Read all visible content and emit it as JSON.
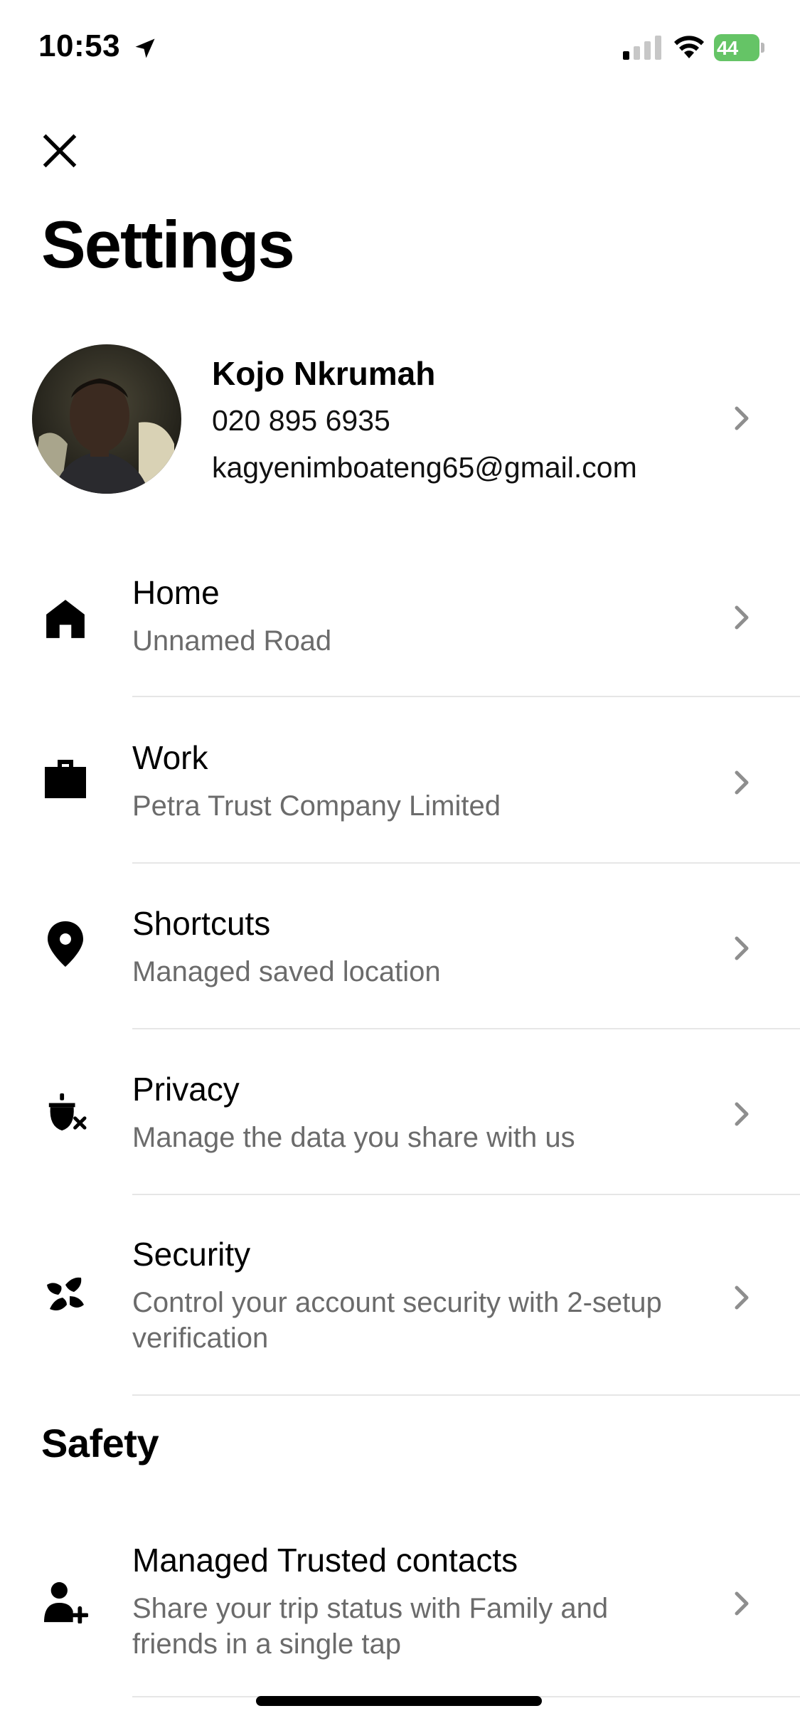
{
  "status_bar": {
    "time": "10:53",
    "battery_level": "44",
    "battery_color": "#65c466"
  },
  "header": {
    "title": "Settings",
    "close_icon": "close-icon"
  },
  "profile": {
    "name": "Kojo Nkrumah",
    "phone": "020 895 6935",
    "email": "kagyenimboateng65@gmail.com"
  },
  "settings_rows": [
    {
      "icon": "home-icon",
      "title": "Home",
      "subtitle": "Unnamed Road"
    },
    {
      "icon": "briefcase-icon",
      "title": "Work",
      "subtitle": "Petra Trust Company Limited"
    },
    {
      "icon": "location-pin-icon",
      "title": "Shortcuts",
      "subtitle": "Managed saved location"
    },
    {
      "icon": "privacy-icon",
      "title": "Privacy",
      "subtitle": "Manage the data you share with us"
    },
    {
      "icon": "security-icon",
      "title": "Security",
      "subtitle": "Control your account security with 2-setup verification"
    }
  ],
  "safety": {
    "title": "Safety",
    "rows": [
      {
        "icon": "add-contact-icon",
        "title": "Managed Trusted contacts",
        "subtitle": "Share your trip status with Family and friends in a single tap"
      }
    ]
  },
  "colors": {
    "text_primary": "#000000",
    "text_secondary": "#6b6b6b",
    "divider": "#e6e6e6",
    "chevron": "#8e8e8e"
  }
}
